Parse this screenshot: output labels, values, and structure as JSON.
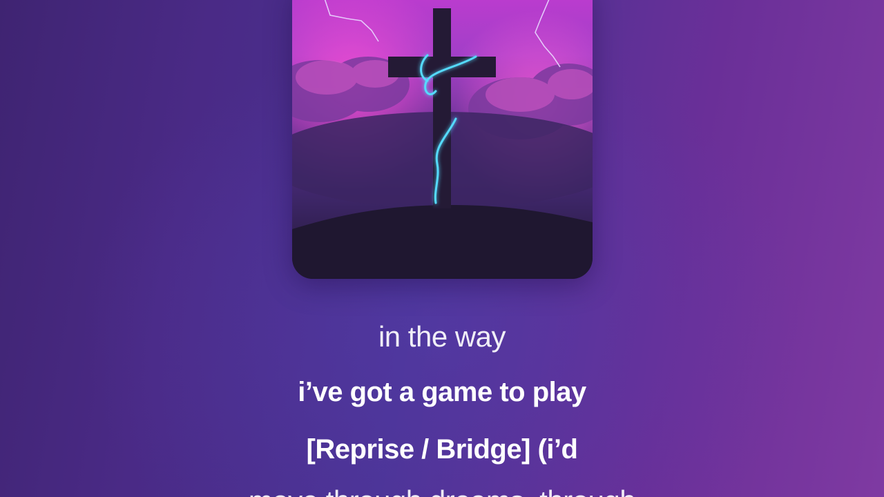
{
  "colors": {
    "background_left": "#3f2472",
    "background_right": "#7f3aa2",
    "lyric_text": "#ffffff",
    "neon_accent": "#4fd8ff"
  },
  "artwork": {
    "icon": "cross-storm-cover-art"
  },
  "lyrics": {
    "previous_line": "in the way",
    "current_line": "i’ve got a game to play",
    "next_line": "[Reprise / Bridge] (i’d",
    "following_line": "move through dreams, through"
  }
}
